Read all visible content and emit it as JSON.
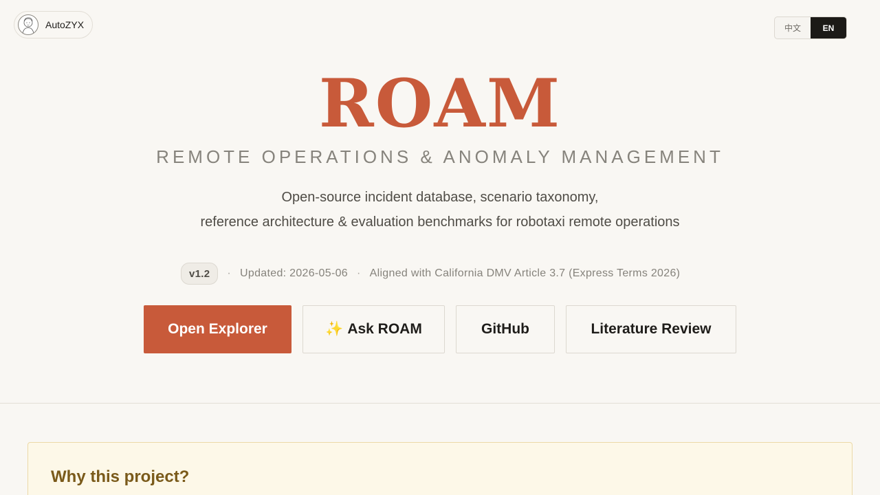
{
  "header": {
    "author_name": "AutoZYX",
    "avatar_icon": "avatar-portrait-icon",
    "lang_options": [
      "中文",
      "EN"
    ],
    "lang_selected": "EN"
  },
  "hero": {
    "title": "ROAM",
    "subtitle": "REMOTE OPERATIONS & ANOMALY MANAGEMENT",
    "description_line1": "Open-source incident database, scenario taxonomy,",
    "description_line2": "reference architecture & evaluation benchmarks for robotaxi remote operations"
  },
  "meta": {
    "version": "v1.2",
    "separator": "·",
    "updated": "Updated: 2026-05-06",
    "aligned": "Aligned with California DMV Article 3.7 (Express Terms 2026)"
  },
  "actions": {
    "open_explorer": "Open Explorer",
    "ask_roam": "Ask ROAM",
    "ask_roam_icon": "✨",
    "github": "GitHub",
    "literature_review": "Literature Review"
  },
  "why_section": {
    "title": "Why this project?"
  },
  "colors": {
    "accent": "#c85a3a",
    "background": "#f9f7f3",
    "card_background": "#fdf8e8",
    "card_title": "#7a5a1a"
  }
}
